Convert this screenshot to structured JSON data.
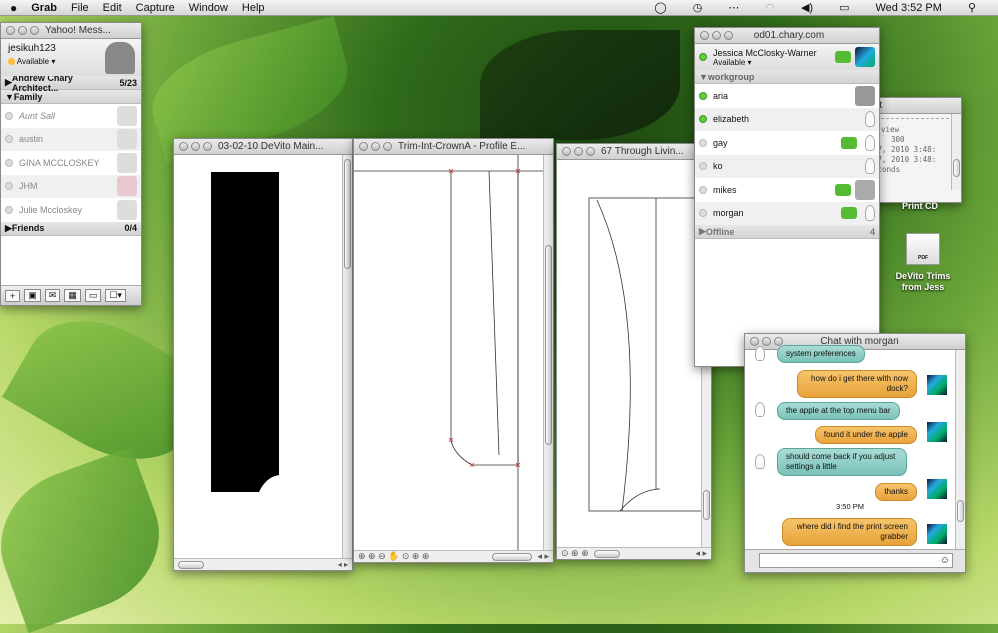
{
  "menubar": {
    "apple": "",
    "items": [
      "Grab",
      "File",
      "Edit",
      "Capture",
      "Window",
      "Help"
    ],
    "clock": "Wed 3:52 PM"
  },
  "yahoo": {
    "title": "Yahoo! Mess...",
    "username": "jesikuh123",
    "status": "Available ▾",
    "groups": [
      {
        "name": "Andrew Chary Architect...",
        "count": "5/23"
      },
      {
        "name": "Family"
      },
      {
        "name": "Friends",
        "count": "0/4"
      }
    ],
    "family": [
      "Aunt Sall",
      "austin",
      "GINA MCCLOSKEY",
      "JHM",
      "Julie Mccloskey"
    ]
  },
  "doc1": {
    "title": "03-02-10 DeVito Main..."
  },
  "doc2": {
    "title": "Trim-Int-CrownA - Profile E..."
  },
  "doc3": {
    "title": "67 Through Livin..."
  },
  "ichat": {
    "title": "od01.chary.com",
    "name": "Jessica McClosky-Warner",
    "status": "Available ▾",
    "group": "workgroup",
    "buddies": [
      "aria",
      "elizabeth",
      "gay",
      "ko",
      "mikes",
      "morgan"
    ],
    "offline": "Offline",
    "offline_count": "4"
  },
  "log": {
    "title": "rt",
    "lines": [
      "view",
      "300",
      "17, 2010 3:48:",
      "17, 2010 3:48:",
      "econds"
    ]
  },
  "desktop": {
    "print_label": "Print CD",
    "pdf_badge": "PDF",
    "pdf_label1": "DeVito Trims",
    "pdf_label2": "from Jess"
  },
  "chat": {
    "title": "Chat with morgan",
    "time": "3:50 PM",
    "messages": [
      "system preferences",
      "how do i get there with now dock?",
      "the apple at the top menu bar",
      "found it under the apple",
      "should come back if you adjust settings a little",
      "thanks",
      "where did i find the print screen grabber"
    ]
  }
}
